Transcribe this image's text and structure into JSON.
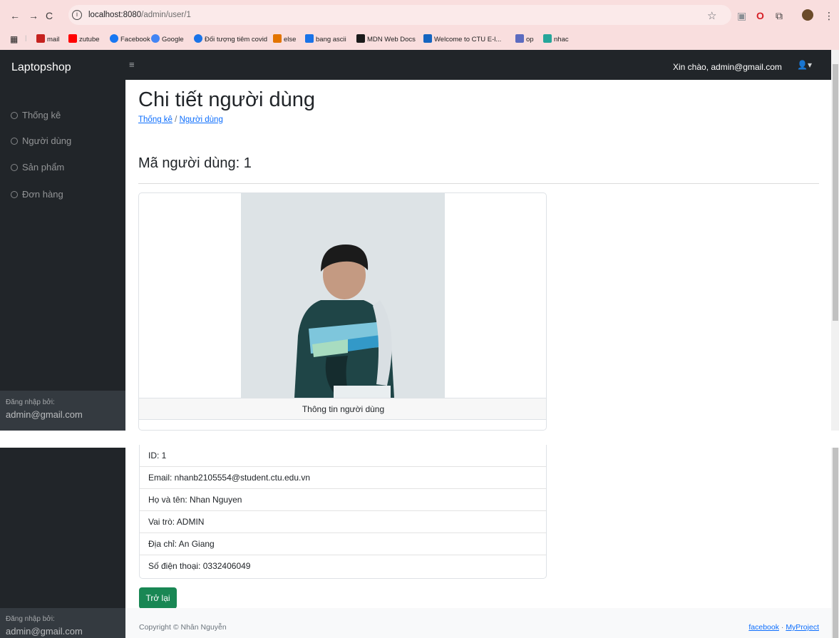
{
  "browser": {
    "url_host": "localhost:8080",
    "url_path": "/admin/user/1",
    "bookmarks": [
      {
        "label": "mail",
        "color": "#c5221f"
      },
      {
        "label": "zutube",
        "color": "#ff0000"
      },
      {
        "label": "Facebook",
        "color": "#1877f2"
      },
      {
        "label": "Google",
        "color": "#4285f4"
      },
      {
        "label": "Đối tượng tiêm covid",
        "color": "#1a73e8"
      },
      {
        "label": "else",
        "color": "#e37400"
      },
      {
        "label": "bang ascii",
        "color": "#1a73e8"
      },
      {
        "label": "MDN Web Docs",
        "color": "#1b1b1b"
      },
      {
        "label": "Welcome to CTU E-l...",
        "color": "#1565c0"
      },
      {
        "label": "op",
        "color": "#5c6bc0"
      },
      {
        "label": "nhac",
        "color": "#26a69a"
      }
    ]
  },
  "navbar": {
    "brand": "Laptopshop",
    "greeting": "Xin chào, admin@gmail.com"
  },
  "sidebar": {
    "items": [
      {
        "label": "Thống kê"
      },
      {
        "label": "Người dùng"
      },
      {
        "label": "Sản phẩm"
      },
      {
        "label": "Đơn hàng"
      }
    ],
    "footer_label": "Đăng nhập bởi:",
    "footer_user": "admin@gmail.com"
  },
  "main": {
    "title": "Chi tiết người dùng",
    "breadcrumb": {
      "home": "Thống kê",
      "separator": "/",
      "current": "Người dùng"
    },
    "subtitle": "Mã người dùng: 1",
    "card_header": "Thông tin người dùng",
    "details": [
      "ID: 1",
      "Email: nhanb2105554@student.ctu.edu.vn",
      "Họ và tên: Nhan Nguyen",
      "Vai trò: ADMIN",
      "Địa chỉ: An Giang",
      "Số điện thoại: 0332406049"
    ],
    "back_button": "Trở lại"
  },
  "footer": {
    "copyright": "Copyright © Nhân Nguyễn",
    "link_facebook": "facebook",
    "link_separator": "·",
    "link_project": "MyProject"
  }
}
